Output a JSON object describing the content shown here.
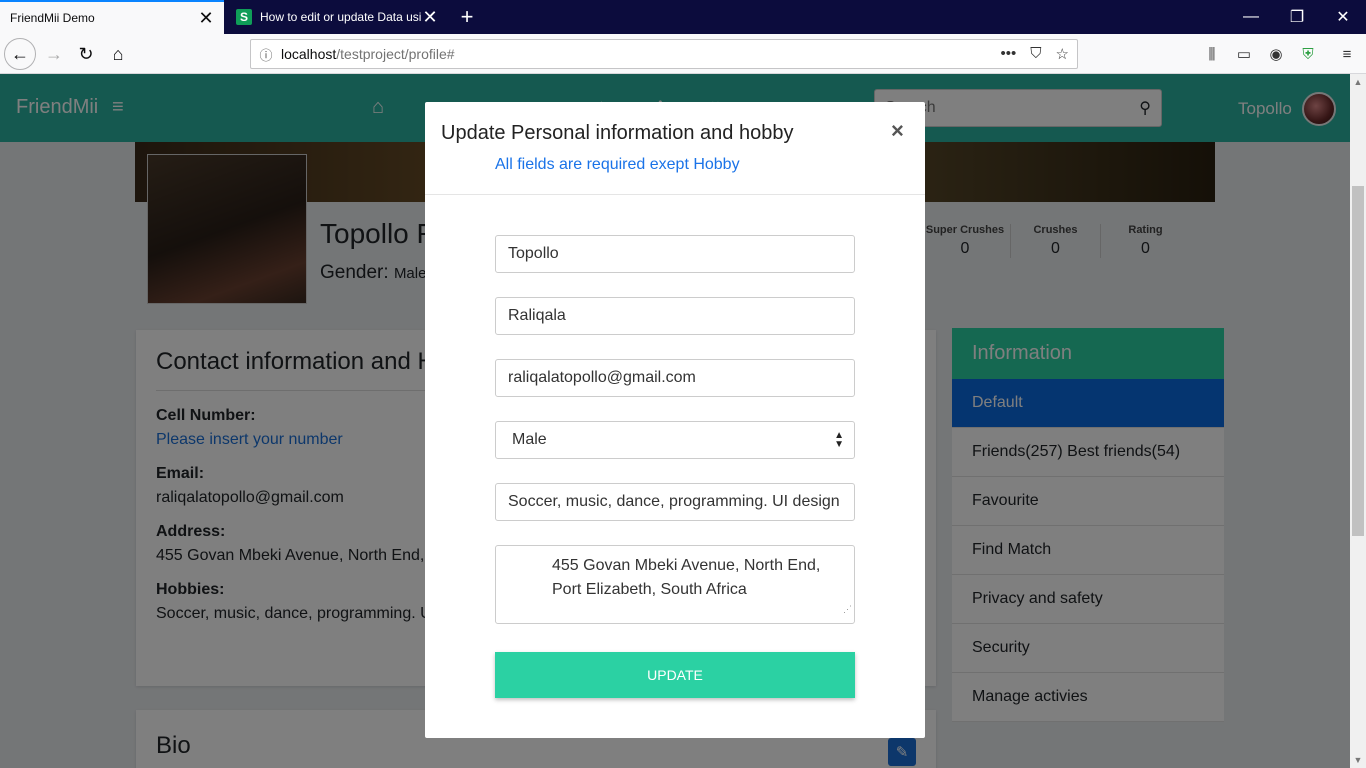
{
  "browser": {
    "tabs": [
      {
        "title": "FriendMii Demo",
        "close": "✕"
      },
      {
        "favicon": "S",
        "title": "How to edit or update Data usin",
        "close": "✕"
      }
    ],
    "new_tab": "+",
    "window_controls": {
      "minimize": "—",
      "restore": "❐",
      "close": "✕"
    },
    "url": {
      "host": "localhost",
      "path": "/testproject/profile#"
    },
    "url_tools": [
      "•••",
      "⛉",
      "☆"
    ]
  },
  "appbar": {
    "brand": "FriendMii",
    "search_placeholder": "Search",
    "user_name": "Topollo",
    "nav_icons": [
      "home-icon",
      "notification-icon",
      "message-icon",
      "friends-icon",
      "upload-icon",
      "user-icon",
      "heart-icon"
    ]
  },
  "profile": {
    "name": "Topollo Raliqala",
    "gender_label": "Gender:",
    "gender_value": "Male",
    "stats": [
      {
        "label": "Super Crushes",
        "value": "0"
      },
      {
        "label": "Crushes",
        "value": "0"
      },
      {
        "label": "Rating",
        "value": "0"
      }
    ]
  },
  "contact": {
    "title": "Contact information and Hobbies",
    "cell_label": "Cell Number:",
    "cell_value": "Please insert your number",
    "email_label": "Email:",
    "email_value": "raliqalatopollo@gmail.com",
    "address_label": "Address:",
    "address_value": "455 Govan Mbeki Avenue, North End, Port Elizabeth, South Africa",
    "hobbies_label": "Hobbies:",
    "hobbies_value": "Soccer, music, dance, programming. UI design"
  },
  "bio": {
    "title": "Bio"
  },
  "info_panel": {
    "title": "Information",
    "items": [
      "Default",
      "Friends(257) Best friends(54)",
      "Favourite",
      "Find Match",
      "Privacy and safety",
      "Security",
      "Manage activies"
    ]
  },
  "modal": {
    "title": "Update Personal information and hobby",
    "subtitle": "All fields are required exept Hobby",
    "close": "×",
    "first_name": "Topollo",
    "last_name": "Raliqala",
    "email": "raliqalatopollo@gmail.com",
    "gender": "Male",
    "hobbies": "Soccer, music, dance, programming. UI design",
    "address_line1": "455 Govan Mbeki Avenue, North End,",
    "address_line2": "Port Elizabeth, South Africa",
    "update_label": "UPDATE"
  },
  "colors": {
    "teal": "#2bb3a0",
    "accent": "#2bd1a3",
    "blue": "#0b6ae0",
    "link": "#1a73e8"
  }
}
